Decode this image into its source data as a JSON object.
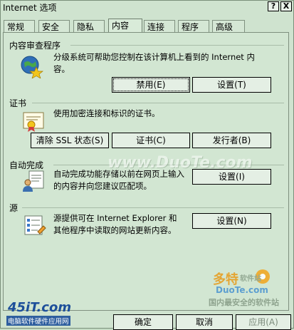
{
  "window": {
    "title": "Internet 选项",
    "help_label": "?",
    "close_label": "X"
  },
  "tabs": [
    {
      "label": "常规"
    },
    {
      "label": "安全"
    },
    {
      "label": "隐私"
    },
    {
      "label": "内容",
      "active": true
    },
    {
      "label": "连接"
    },
    {
      "label": "程序"
    },
    {
      "label": "高级"
    }
  ],
  "content_advisor": {
    "heading": "内容审查程序",
    "description_line1": "分级系统可帮助您控制在该计算机上看到的 Internet 内",
    "description_line2": "容。",
    "enable_button": "禁用(E)",
    "settings_button": "设置(T)"
  },
  "certificates": {
    "heading": "证书",
    "description": "使用加密连接和标识的证书。",
    "clear_ssl_button": "清除 SSL 状态(S)",
    "certificates_button": "证书(C)",
    "publishers_button": "发行者(B)"
  },
  "autocomplete": {
    "heading": "自动完成",
    "description_line1": "自动完成功能存储以前在网页上输入",
    "description_line2": "的内容并向您建议匹配项。",
    "settings_button": "设置(I)"
  },
  "feeds": {
    "heading": "源",
    "description_line1": "源提供可在 Internet Explorer 和",
    "description_line2": "其他程序中读取的网站更新内容。",
    "settings_button": "设置(N)"
  },
  "dialog_buttons": {
    "ok": "确定",
    "cancel": "取消",
    "apply": "应用(A)"
  },
  "watermarks": {
    "center": "www.DuoTe.com",
    "logo_left": "45iT.com",
    "logo_left_sub": "电脑软件硬件应用网",
    "logo_right_brand": "多特",
    "logo_right_brand_suffix": "软件站",
    "logo_right_site": "DuoTe.com",
    "logo_right_slogan": "国内最安全的软件站"
  }
}
